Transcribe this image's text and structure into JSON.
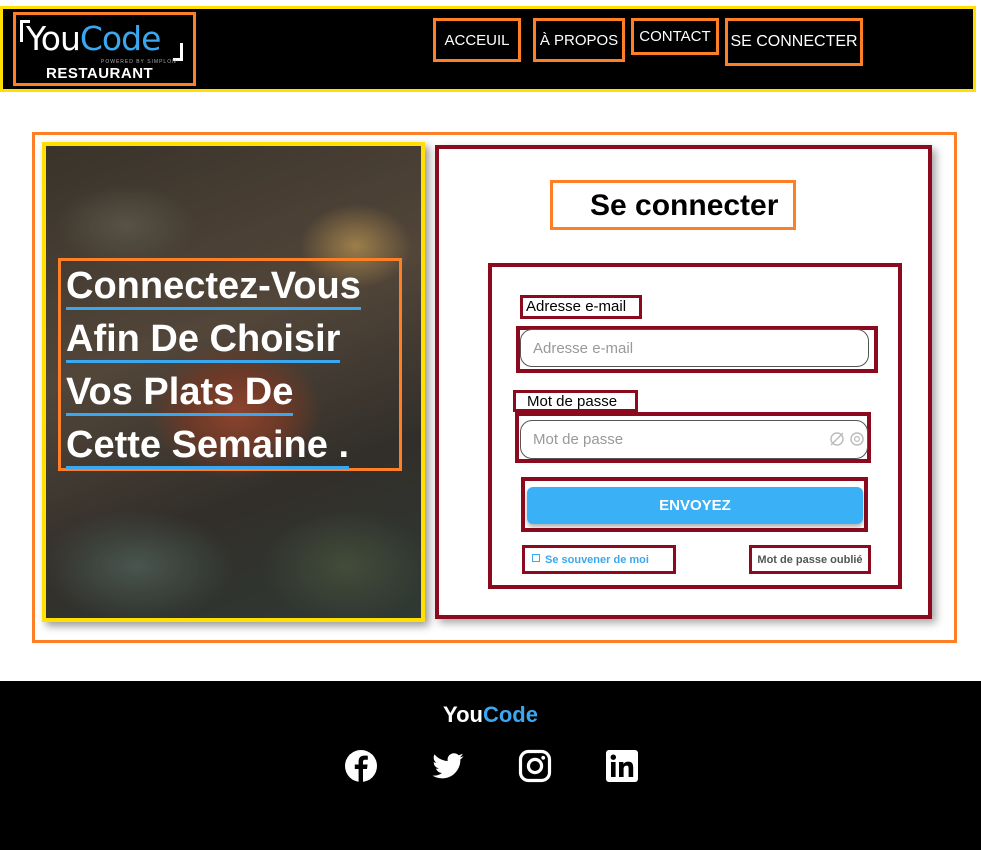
{
  "header": {
    "logo": {
      "word_you": "You",
      "word_code": "Code",
      "powered": "POWERED BY SIMPLON",
      "subtitle": "RESTAURANT"
    },
    "nav": [
      {
        "label": "ACCEUIL"
      },
      {
        "label": "À PROPOS"
      },
      {
        "label": "CONTACT"
      },
      {
        "label": "SE CONNECTER"
      }
    ]
  },
  "hero": {
    "lines": [
      "Connectez-Vous",
      "Afin De Choisir",
      "Vos Plats De",
      "Cette Semaine ."
    ]
  },
  "login": {
    "title": "Se connecter",
    "email_label": "Adresse e-mail",
    "email_placeholder": "Adresse e-mail",
    "email_value": "",
    "password_label": "Mot de passe",
    "password_placeholder": "Mot de passe",
    "password_value": "",
    "submit_label": "ENVOYEZ",
    "remember_label": "Se souvener de moi",
    "forgot_label": "Mot de passe oublié"
  },
  "footer": {
    "brand_you": "You",
    "brand_code": "Code",
    "social": [
      "facebook-icon",
      "twitter-icon",
      "instagram-icon",
      "linkedin-icon"
    ]
  },
  "colors": {
    "accent": "#3aa8f0",
    "header_border": "#ffe000",
    "highlight_border": "#ff7f27",
    "form_border": "#8b0a1d"
  }
}
